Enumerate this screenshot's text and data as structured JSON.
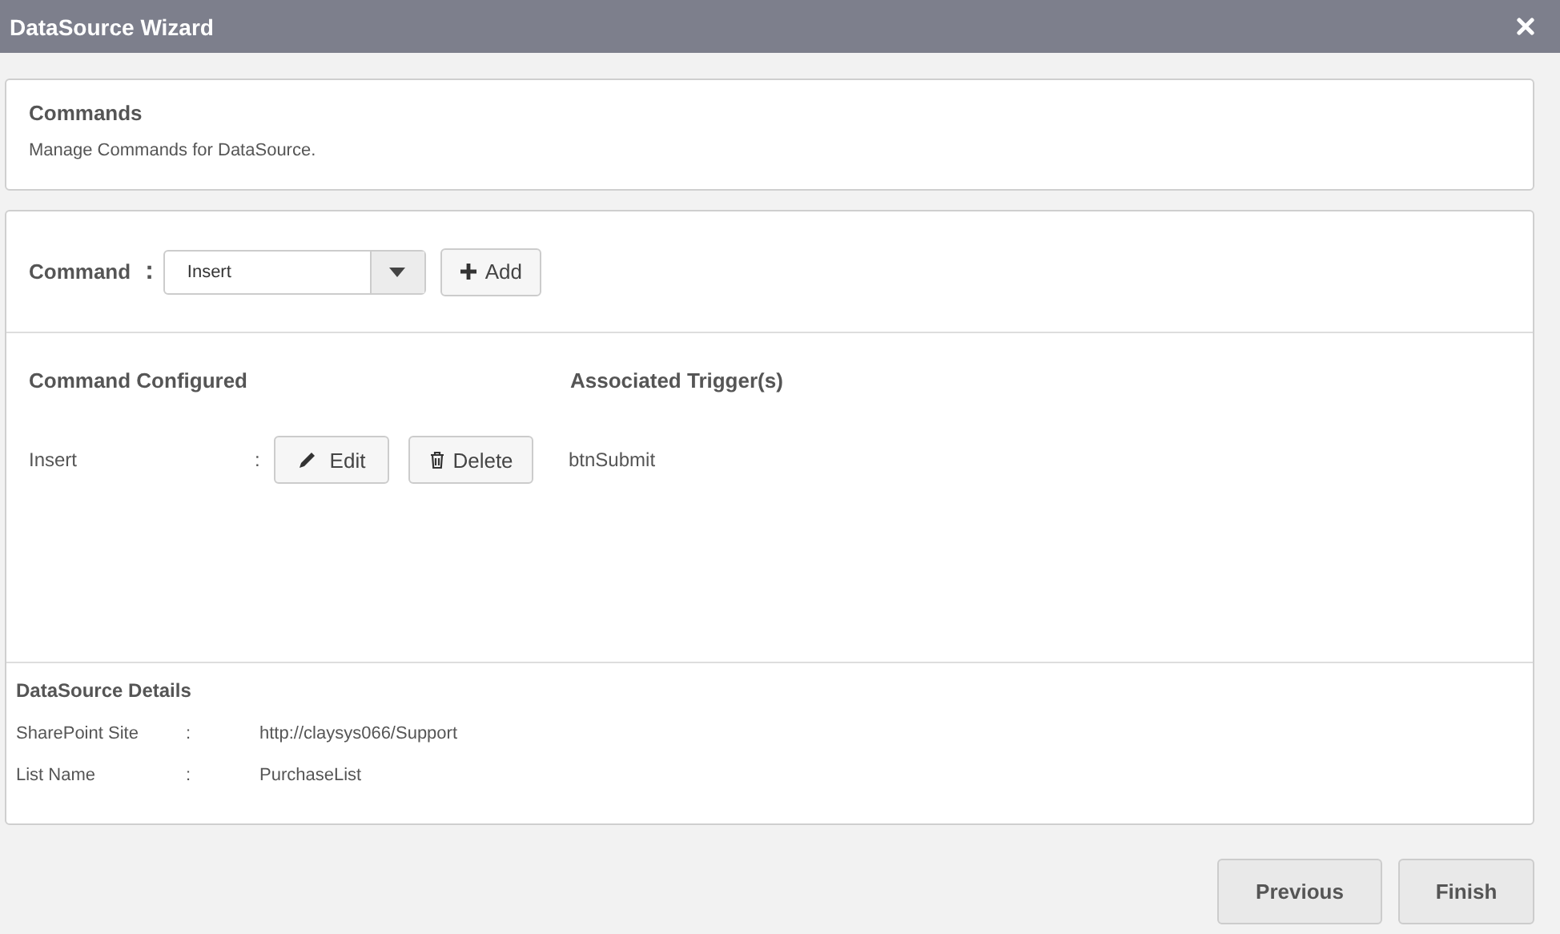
{
  "window": {
    "title": "DataSource Wizard"
  },
  "header": {
    "title": "Commands",
    "description": "Manage Commands for DataSource."
  },
  "command_picker": {
    "label": "Command",
    "separator": ":",
    "value": "Insert",
    "add_button": "Add"
  },
  "configured": {
    "column_1": "Command Configured",
    "column_2": "Associated Trigger(s)",
    "rows": [
      {
        "name": "Insert",
        "separator": ":",
        "edit_button": "Edit",
        "delete_button": "Delete",
        "trigger": "btnSubmit"
      }
    ]
  },
  "details": {
    "title": "DataSource Details",
    "rows": [
      {
        "label": "SharePoint Site",
        "separator": ":",
        "value": "http://claysys066/Support"
      },
      {
        "label": "List Name",
        "separator": ":",
        "value": "PurchaseList"
      }
    ]
  },
  "buttons": [
    "Previous",
    "Finish"
  ]
}
